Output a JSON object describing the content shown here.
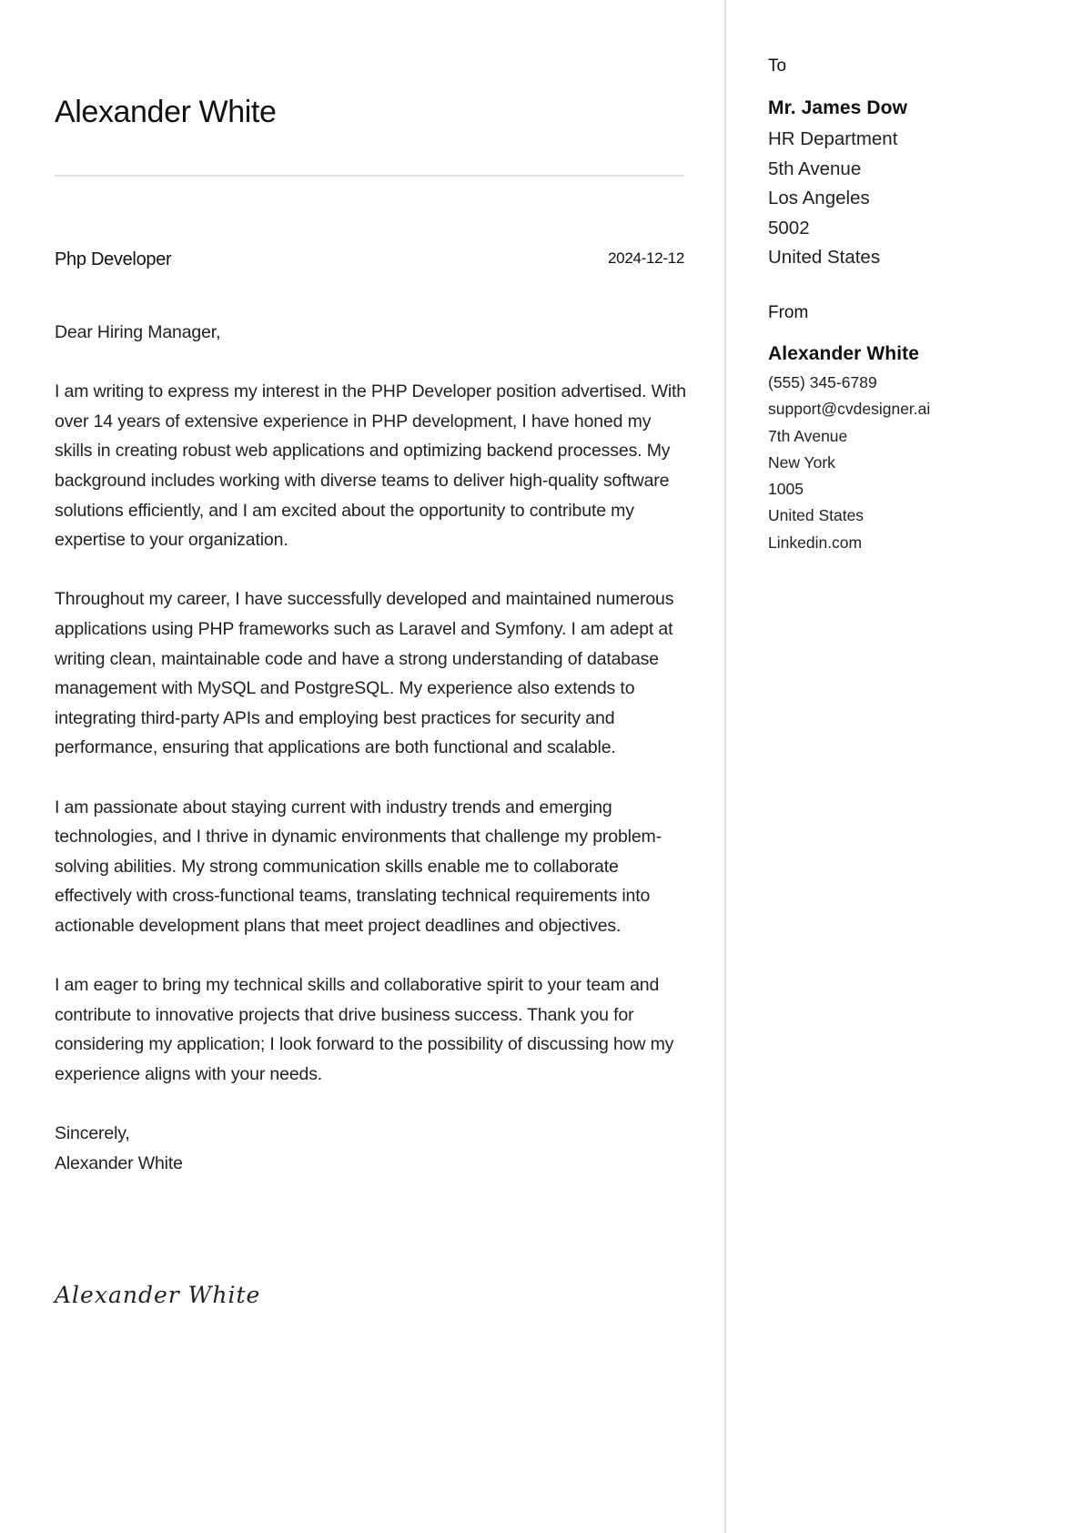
{
  "header": {
    "name": "Alexander White",
    "role": "Php Developer",
    "date": "2024-12-12"
  },
  "letter": {
    "salutation": "Dear Hiring Manager,",
    "paragraphs": [
      "I am writing to express my interest in the PHP Developer position advertised. With over 14 years of extensive experience in PHP development, I have honed my skills in creating robust web applications and optimizing backend processes. My background includes working with diverse teams to deliver high-quality software solutions efficiently, and I am excited about the opportunity to contribute my expertise to your organization.",
      "Throughout my career, I have successfully developed and maintained numerous applications using PHP frameworks such as Laravel and Symfony. I am adept at writing clean, maintainable code and have a strong understanding of database management with MySQL and PostgreSQL. My experience also extends to integrating third-party APIs and employing best practices for security and performance, ensuring that applications are both functional and scalable.",
      "I am passionate about staying current with industry trends and emerging technologies, and I thrive in dynamic environments that challenge my problem-solving abilities. My strong communication skills enable me to collaborate effectively with cross-functional teams, translating technical requirements into actionable development plans that meet project deadlines and objectives.",
      "I am eager to bring my technical skills and collaborative spirit to your team and contribute to innovative projects that drive business success. Thank you for considering my application; I look forward to the possibility of discussing how my experience aligns with your needs."
    ],
    "closing": "Sincerely,",
    "closing_name": "Alexander White",
    "signature": "Alexander White"
  },
  "recipient": {
    "label": "To",
    "name": "Mr. James Dow",
    "lines": [
      "HR Department",
      "5th Avenue",
      "Los Angeles",
      "5002",
      "United States"
    ]
  },
  "sender": {
    "label": "From",
    "name": "Alexander White",
    "lines": [
      "(555) 345-6789",
      "support@cvdesigner.ai",
      "7th Avenue",
      "New York",
      "1005",
      "United States",
      "Linkedin.com"
    ]
  }
}
